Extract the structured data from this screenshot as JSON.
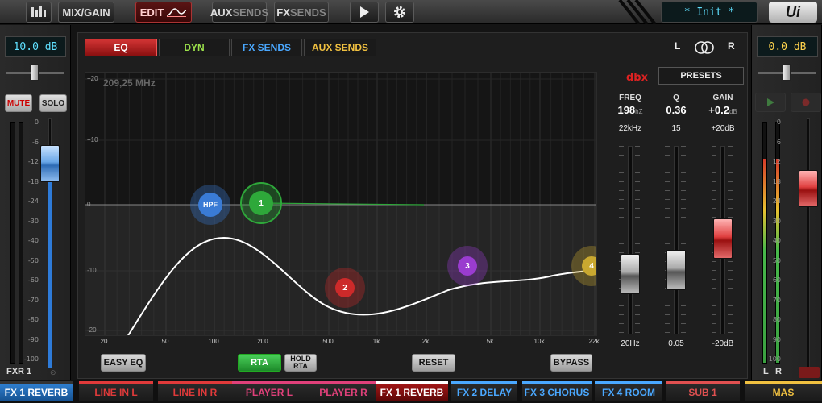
{
  "toolbar": {
    "mix_gain": "MIX/GAIN",
    "edit": "EDIT",
    "aux_sends_aux": "AUX",
    "aux_sends_sends": "SENDS",
    "fx_sends_fx": "FX",
    "fx_sends_sends": "SENDS",
    "status": "* Init *",
    "logo": "Ui"
  },
  "left_strip": {
    "gain": "10.0 dB",
    "mute": "MUTE",
    "solo": "SOLO",
    "scale": [
      "0",
      "-6",
      "-12",
      "-18",
      "-24",
      "-30",
      "-40",
      "-50",
      "-60",
      "-70",
      "-80",
      "-90",
      "-100"
    ],
    "name": "FXR 1",
    "fader_level": 0.82
  },
  "right_strip": {
    "gain": "0.0 dB",
    "scale": [
      "0",
      "6",
      "12",
      "18",
      "24",
      "30",
      "40",
      "50",
      "60",
      "70",
      "80",
      "90",
      "100"
    ],
    "left_label": "L",
    "right_label": "R",
    "fader_level": 0.72
  },
  "tabs": [
    {
      "label": "EQ",
      "color": "#ffffff"
    },
    {
      "label": "DYN",
      "color": "#9be04a"
    },
    {
      "label": "FX SENDS",
      "color": "#4aa8ff"
    },
    {
      "label": "AUX SENDS",
      "color": "#f0c040"
    }
  ],
  "link": {
    "left": "L",
    "right": "R"
  },
  "eq": {
    "freq_readout": "209,25 MHz",
    "y_labels": [
      "+20",
      "+10",
      "0",
      "-10",
      "-20"
    ],
    "x_labels": [
      "20",
      "50",
      "100",
      "200",
      "500",
      "1k",
      "2k",
      "5k",
      "10k",
      "22k"
    ],
    "bands": [
      {
        "label": "HPF",
        "color": "#3a7bd5"
      },
      {
        "label": "1",
        "color": "#2ea83a"
      },
      {
        "label": "2",
        "color": "#cc2a2a"
      },
      {
        "label": "3",
        "color": "#9a3ccf"
      },
      {
        "label": "4",
        "color": "#c9a830"
      }
    ]
  },
  "buttons": {
    "easy_eq": "EASY EQ",
    "rta": "RTA",
    "hold_rta_1": "HOLD",
    "hold_rta_2": "RTA",
    "reset": "RESET",
    "bypass": "BYPASS"
  },
  "dbx": {
    "logo": "dbx",
    "presets": "PRESETS",
    "params": [
      {
        "name": "FREQ",
        "value": "198",
        "unit": "hZ",
        "max": "22kHz",
        "min": "20Hz",
        "level": 0.32
      },
      {
        "name": "Q",
        "value": "0.36",
        "unit": "",
        "max": "15",
        "min": "0.05",
        "level": 0.34
      },
      {
        "name": "GAIN",
        "value": "+0.2",
        "unit": "dB",
        "max": "+20dB",
        "min": "-20dB",
        "level": 0.51
      }
    ]
  },
  "channels": [
    {
      "label": "FX 1 REVERB",
      "color": "#ffffff"
    },
    {
      "label": "LINE IN L",
      "color": "#e03a3a"
    },
    {
      "label": "LINE IN R",
      "color": "#e03a3a"
    },
    {
      "label": "PLAYER L",
      "color": "#e0407a"
    },
    {
      "label": "PLAYER R",
      "color": "#e0407a"
    },
    {
      "label": "FX 1 REVERB",
      "color": "#ffffff"
    },
    {
      "label": "FX 2 DELAY",
      "color": "#4aa8ff"
    },
    {
      "label": "FX 3 CHORUS",
      "color": "#4aa8ff"
    },
    {
      "label": "FX 4 ROOM",
      "color": "#4aa8ff"
    },
    {
      "label": "SUB 1",
      "color": "#e05050"
    },
    {
      "label": "MAS",
      "color": "#f0c040"
    }
  ]
}
